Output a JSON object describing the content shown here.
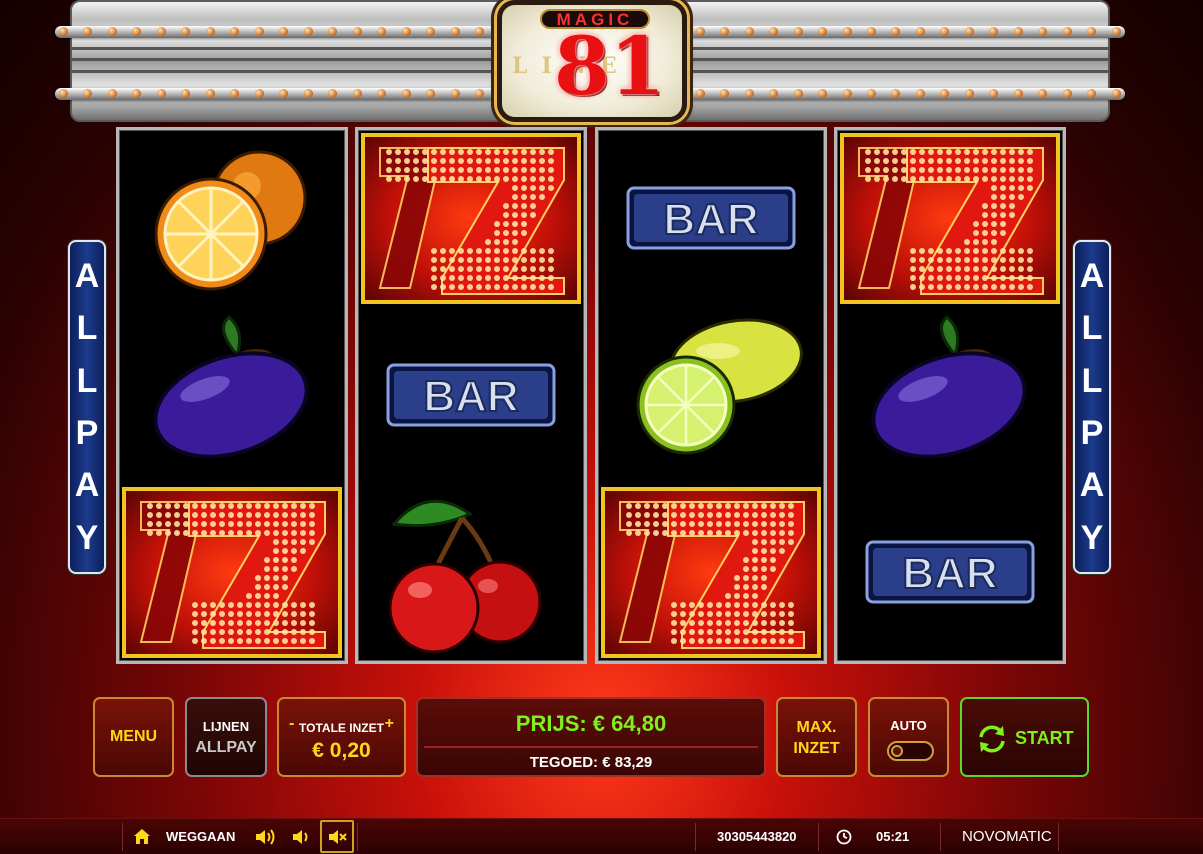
{
  "game": {
    "logo_top": "MAGIC",
    "logo_number": "81",
    "logo_bottom": "LINES"
  },
  "side_panels": {
    "left_text": "ALLPAY",
    "right_text": "ALLPAY"
  },
  "reels": [
    [
      "orange",
      "plum",
      "seven"
    ],
    [
      "seven",
      "bar",
      "cherry"
    ],
    [
      "bar",
      "lemon",
      "seven"
    ],
    [
      "seven",
      "plum",
      "bar"
    ]
  ],
  "symbols": {
    "bar_text": "BAR"
  },
  "controls": {
    "menu_label": "MENU",
    "lines_label": "LIJNEN",
    "lines_value": "ALLPAY",
    "bet_minus": "-",
    "bet_label": "TOTALE INZET",
    "bet_plus": "+",
    "bet_value": "€ 0,20",
    "prize_text": "PRIJS: € 64,80",
    "credit_text": "TEGOED: € 83,29",
    "max_bet_line1": "MAX.",
    "max_bet_line2": "INZET",
    "auto_label": "AUTO",
    "start_label": "START"
  },
  "bottom_bar": {
    "exit_label": "WEGGAAN",
    "session_id": "30305443820",
    "time": "05:21",
    "brand": "NOVOMATIC"
  },
  "colors": {
    "accent_gold": "#ffd71a",
    "prize_green": "#7ef01a",
    "panel_blue": "#1c3b8c",
    "seven_red": "#e81010"
  }
}
